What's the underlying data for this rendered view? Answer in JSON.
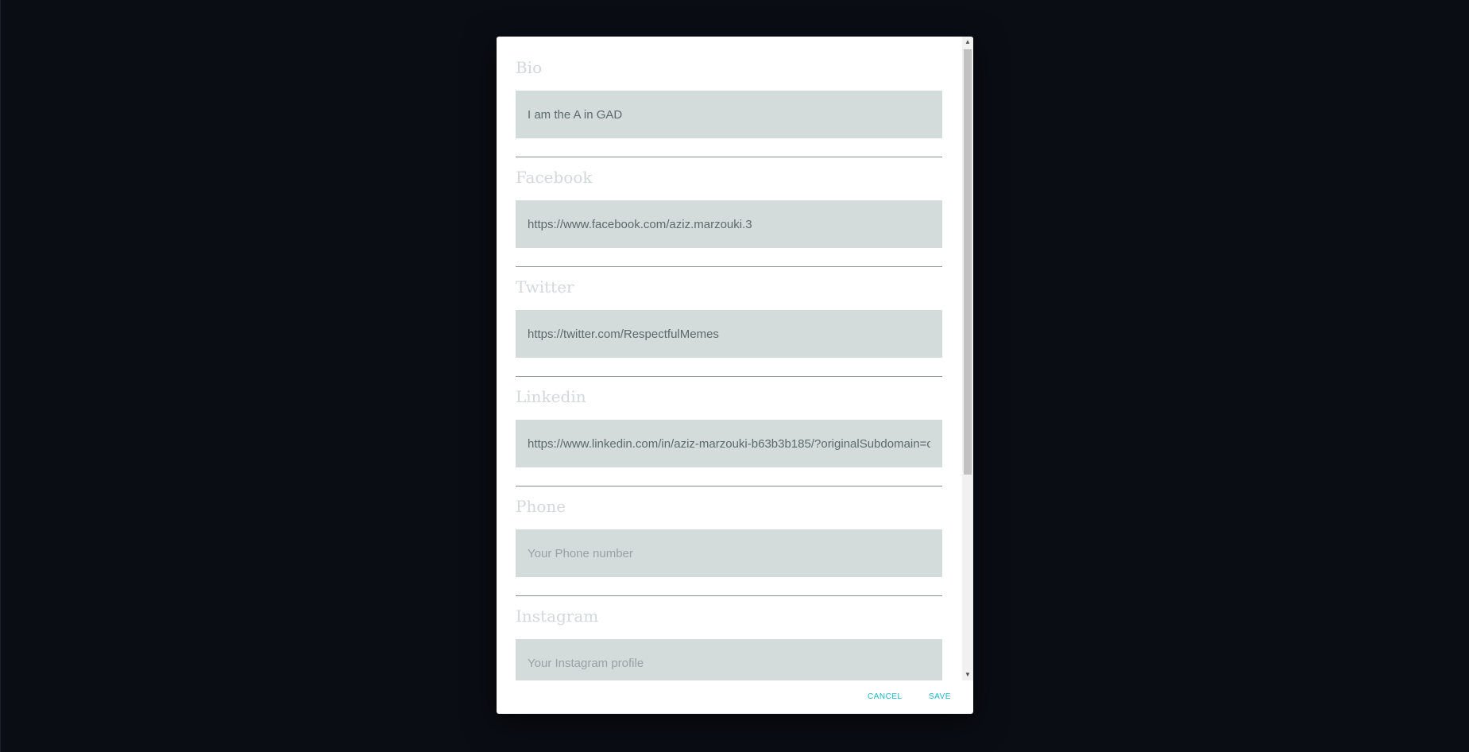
{
  "dialog": {
    "fields": [
      {
        "label": "Bio",
        "value": "I am the A in GAD",
        "placeholder": ""
      },
      {
        "label": "Facebook",
        "value": "https://www.facebook.com/aziz.marzouki.3",
        "placeholder": ""
      },
      {
        "label": "Twitter",
        "value": "https://twitter.com/RespectfulMemes",
        "placeholder": ""
      },
      {
        "label": "Linkedin",
        "value": "https://www.linkedin.com/in/aziz-marzouki-b63b3b185/?originalSubdomain=c",
        "placeholder": ""
      },
      {
        "label": "Phone",
        "value": "",
        "placeholder": "Your Phone number"
      },
      {
        "label": "Instagram",
        "value": "",
        "placeholder": "Your Instagram profile"
      }
    ],
    "actions": {
      "cancel_label": "CANCEL",
      "save_label": "SAVE"
    }
  },
  "colors": {
    "accent": "#19b7c9",
    "input_background": "#d3dbdb",
    "label": "#d3d8da",
    "backdrop": "#0a0d14"
  },
  "icons": {
    "scroll_up": "triangle-up-icon",
    "scroll_down": "triangle-down-icon"
  }
}
